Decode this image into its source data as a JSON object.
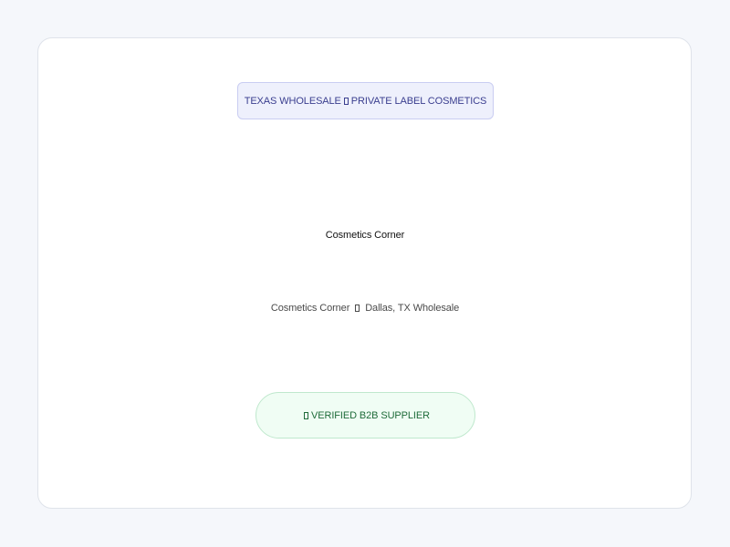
{
  "badge": {
    "left_text": "TEXAS WHOLESALE",
    "right_text": "PRIVATE LABEL COSMETICS"
  },
  "title": "Cosmetics Corner",
  "subtitle": {
    "left_text": "Cosmetics Corner",
    "right_text": "Dallas, TX Wholesale"
  },
  "verified_pill": {
    "label": "VERIFIED B2B SUPPLIER"
  },
  "colors": {
    "page_background": "#f5f7fb",
    "card_background": "#ffffff",
    "badge_background": "#eef0fc",
    "badge_text": "#3a3e8f",
    "pill_background": "#f0fdf4",
    "pill_text": "#1f6b3a"
  }
}
